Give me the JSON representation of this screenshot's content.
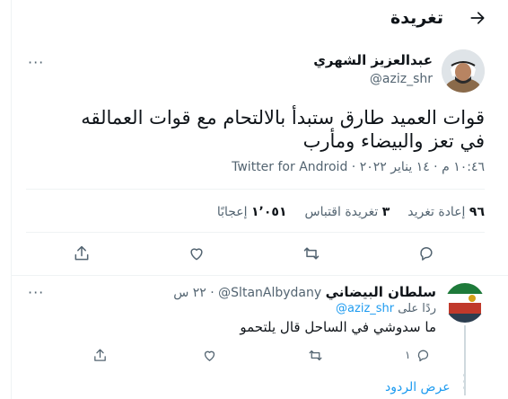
{
  "header": {
    "title": "تغريدة",
    "back_icon": "arrow-left-icon"
  },
  "tweet": {
    "author_name": "عبدالعزيز الشهري",
    "author_handle": "@aziz_shr",
    "text": "قوات العميد طارق ستبدأ بالالتحام مع قوات العمالقه في تعز والبيضاء ومأرب",
    "time_date": "١٠:٤٦ م · ١٤ يناير ٢٠٢٢ ·",
    "source": "Twitter for Android",
    "stats": {
      "retweets_count": "٩٦",
      "retweets_label": "إعادة تغريد",
      "quotes_count": "٣",
      "quotes_label": "تغريدة اقتباس",
      "likes_count": "١٬٠٥١",
      "likes_label": "إعجابًا"
    }
  },
  "reply": {
    "author_name": "سلطان البيضاني",
    "author_handle": "@SltanAlbydany",
    "time": "· ٢٢ س",
    "replying_prefix": "ردًا على",
    "replying_to": "@aziz_shr",
    "text": "ما سدوشي في الساحل قال يلتحمو",
    "reply_count": "١"
  },
  "show_replies": "عرض الردود",
  "more_label": "···",
  "colors": {
    "accent": "#1d9bf0",
    "secondary_text": "#536471",
    "divider": "#eff3f4"
  }
}
